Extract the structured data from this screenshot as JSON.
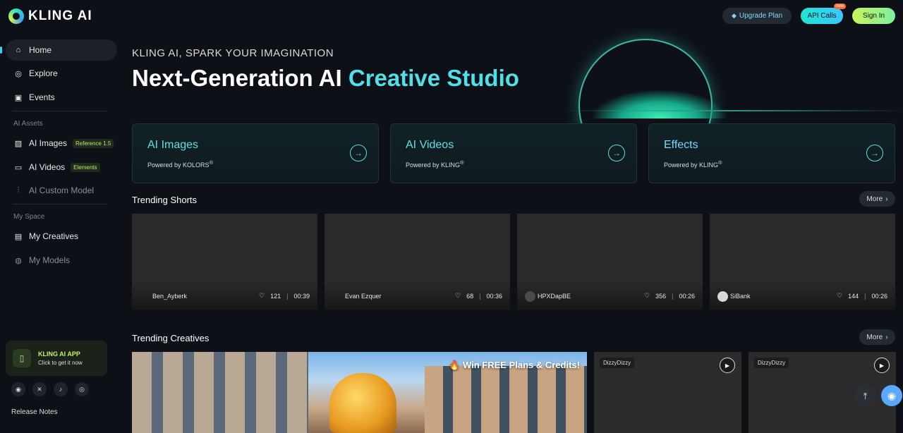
{
  "brand": {
    "name": "KLING AI"
  },
  "sidebar": {
    "nav": [
      {
        "label": "Home",
        "icon": "home-icon"
      },
      {
        "label": "Explore",
        "icon": "compass-icon"
      },
      {
        "label": "Events",
        "icon": "gift-icon"
      }
    ],
    "ai_assets_label": "AI Assets",
    "assets": [
      {
        "label": "AI Images",
        "tag": "Reference 1.5"
      },
      {
        "label": "AI Videos",
        "tag": "Elements"
      },
      {
        "label": "AI Custom Model"
      }
    ],
    "my_space_label": "My Space",
    "space": [
      {
        "label": "My Creatives"
      },
      {
        "label": "My Models"
      }
    ],
    "app_card": {
      "title": "KLING AI APP",
      "subtitle": "Click to get it now"
    },
    "release_notes": "Release Notes"
  },
  "topbar": {
    "upgrade": "Upgrade Plan",
    "api": "API Calls",
    "api_badge": "new",
    "signin": "Sign In"
  },
  "hero": {
    "subtitle": "KLING AI, SPARK YOUR IMAGINATION",
    "title_plain": "Next-Generation AI ",
    "title_accent": "Creative Studio"
  },
  "cards": [
    {
      "title": "AI Images",
      "powered": "Powered by KOLORS",
      "mark": "®"
    },
    {
      "title": "AI Videos",
      "powered": "Powered by KLING",
      "mark": "®"
    },
    {
      "title": "Effects",
      "powered": "Powered by KLING",
      "mark": "®"
    }
  ],
  "trending_shorts": {
    "title": "Trending Shorts",
    "more": "More",
    "items": [
      {
        "author": "Ben_Ayberk",
        "likes": "121",
        "duration": "00:39"
      },
      {
        "author": "Evan Ezquer",
        "likes": "68",
        "duration": "00:36"
      },
      {
        "author": "HPXDapBE",
        "likes": "356",
        "duration": "00:26"
      },
      {
        "author": "SiBank",
        "likes": "144",
        "duration": "00:26"
      }
    ]
  },
  "trending_creatives": {
    "title": "Trending Creatives",
    "more": "More",
    "promo": "Win FREE Plans & Credits!",
    "tags": [
      "DizzyDizzy",
      "DizzyDizzy"
    ]
  },
  "colors": {
    "accent": "#4fe0e8",
    "lime": "#c8f55a",
    "bg": "#0d1117"
  }
}
